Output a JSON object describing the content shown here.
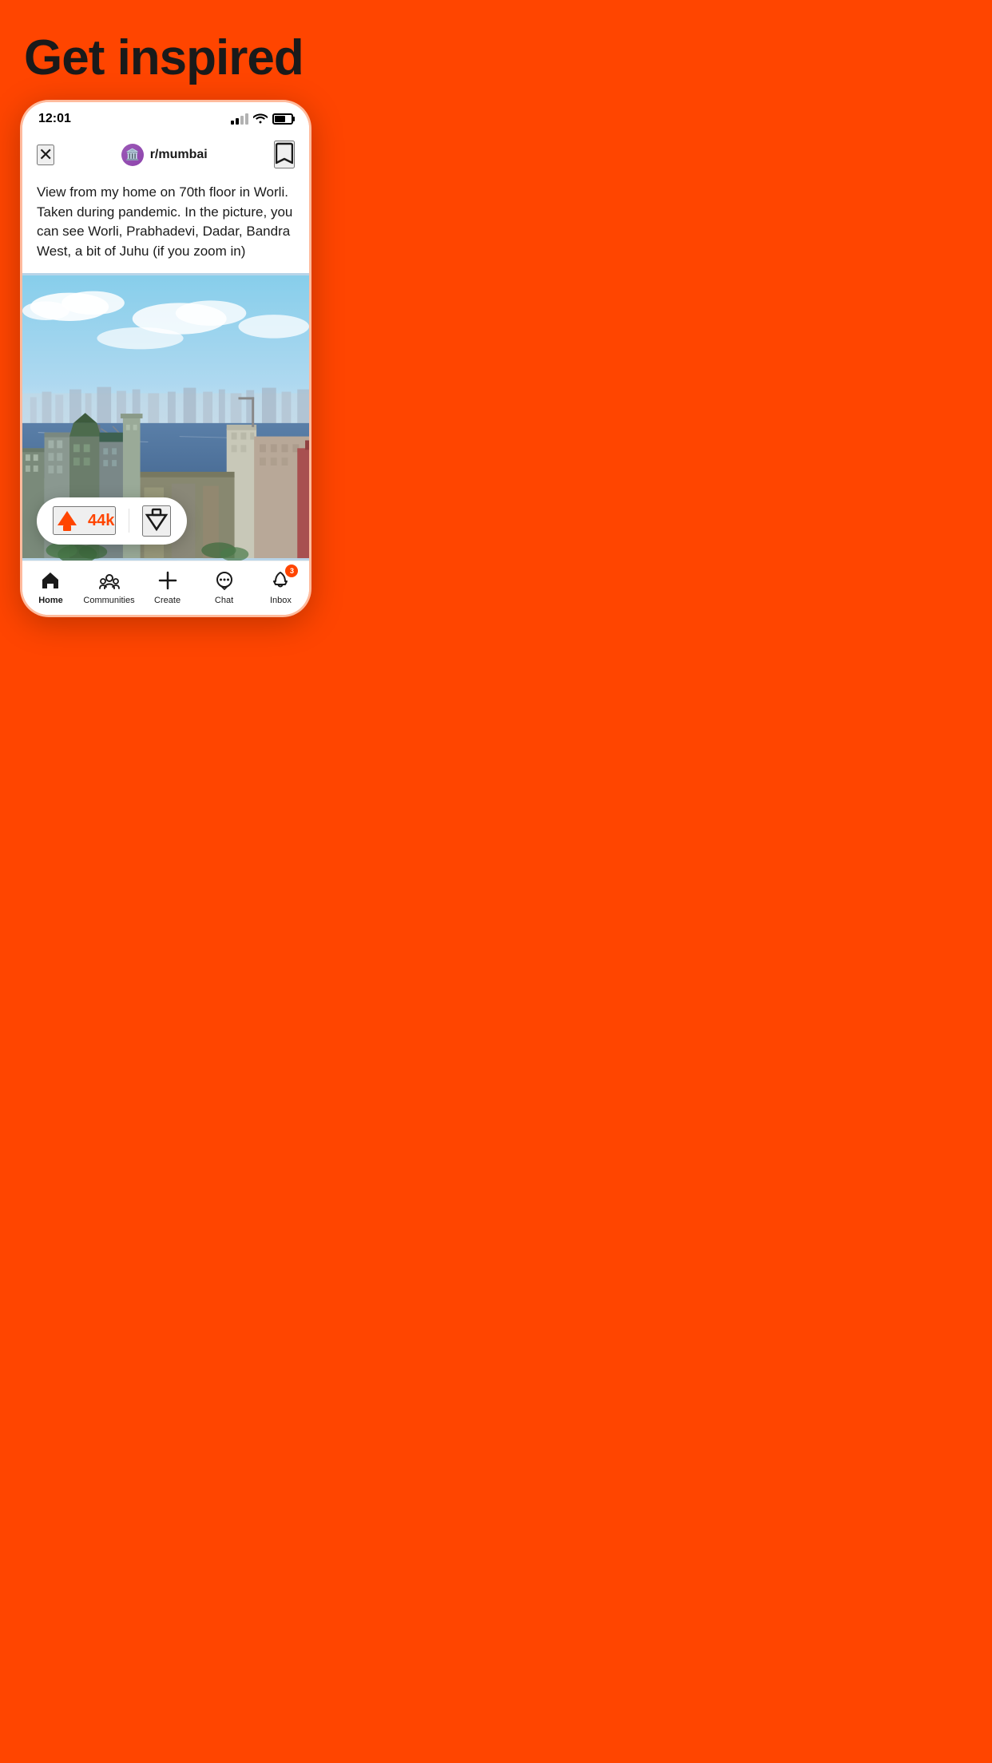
{
  "hero": {
    "title": "Get inspired"
  },
  "status_bar": {
    "time": "12:01",
    "battery_level": 65
  },
  "post": {
    "subreddit": "r/mumbai",
    "subreddit_icon": "🏛️",
    "title": "View from my home on 70th floor in Worli. Taken during pandemic. In the picture, you can see Worli, Prabhadevi, Dadar, Bandra West, a bit of Juhu (if you zoom in)",
    "vote_count": "44k"
  },
  "bottom_nav": {
    "items": [
      {
        "id": "home",
        "label": "Home",
        "active": true
      },
      {
        "id": "communities",
        "label": "Communities",
        "active": false
      },
      {
        "id": "create",
        "label": "Create",
        "active": false
      },
      {
        "id": "chat",
        "label": "Chat",
        "active": false
      },
      {
        "id": "inbox",
        "label": "Inbox",
        "active": false
      }
    ],
    "inbox_badge": "3"
  },
  "colors": {
    "brand_orange": "#FF4500",
    "bg_orange": "#FF4500"
  }
}
